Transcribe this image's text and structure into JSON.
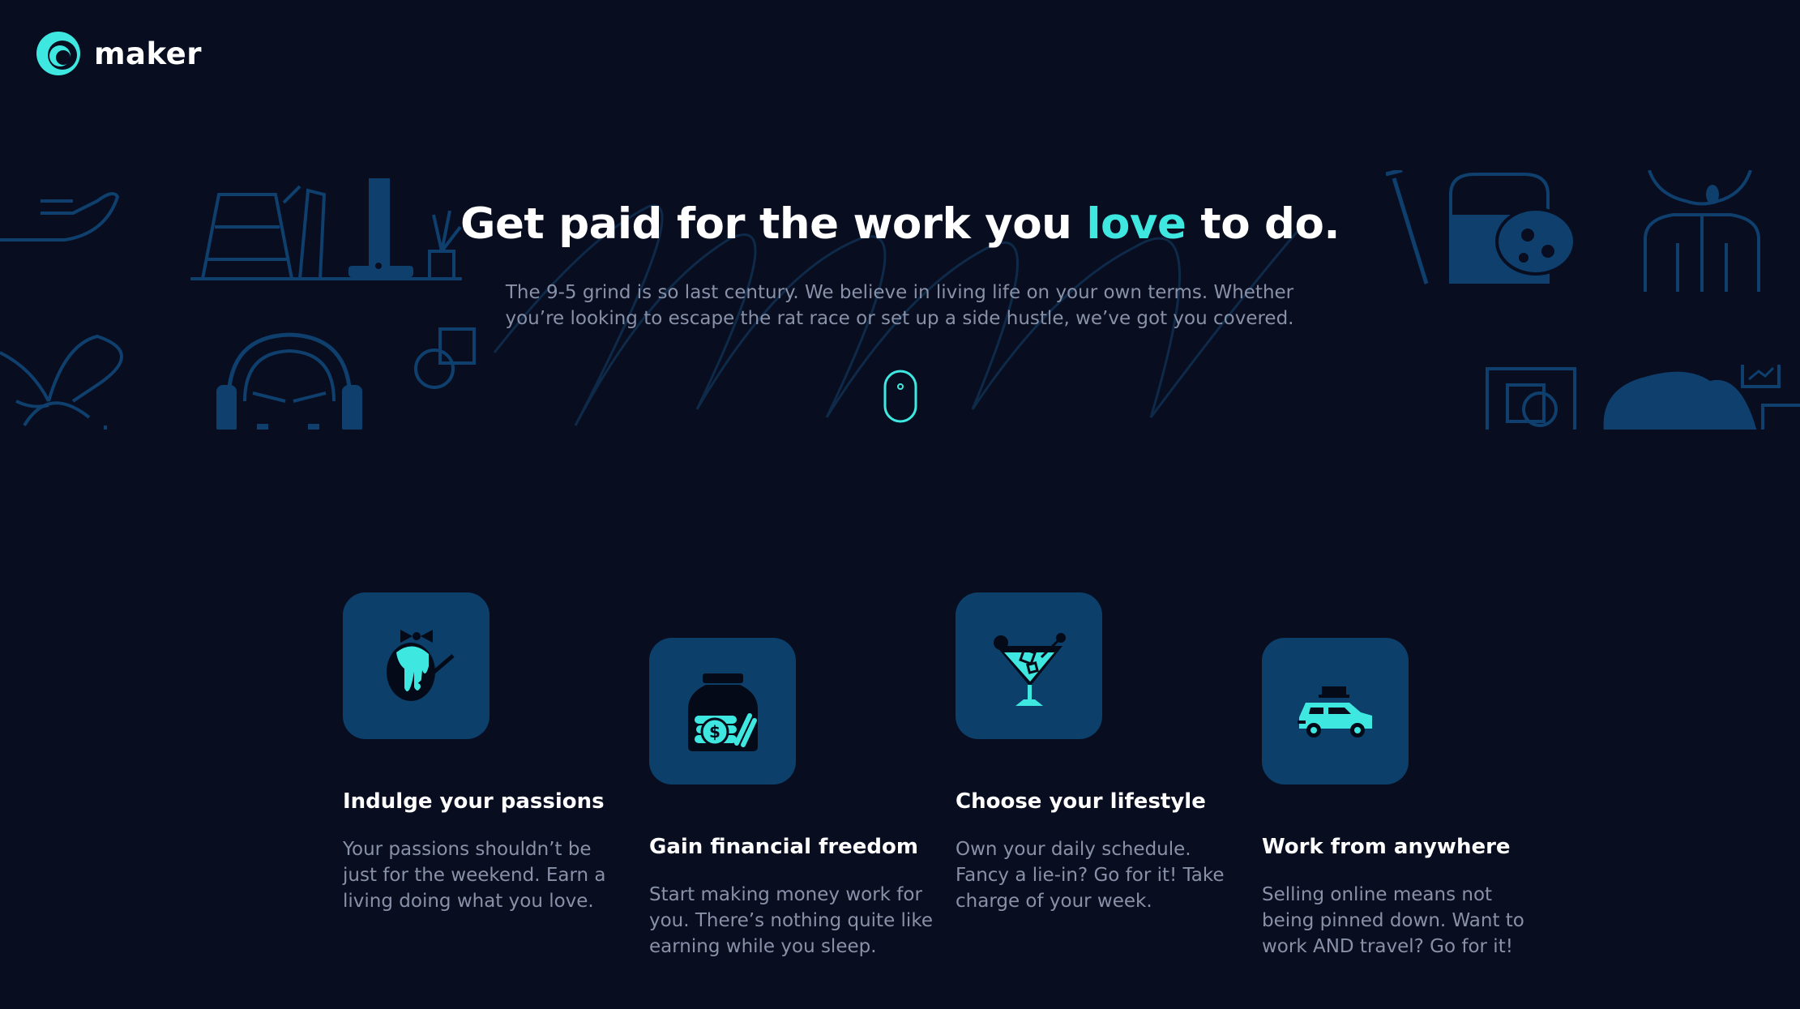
{
  "brand": {
    "name": "maker",
    "accent_color": "#3ee8e0",
    "background_color": "#080d20",
    "logo_icon": "maker-logo-icon"
  },
  "hero": {
    "title_before": "Get paid for the work you ",
    "title_accent": "love",
    "title_after": " to do.",
    "subtitle": "The 9-5 grind is so last century. We believe in living life on your own terms. Whether you’re looking to escape the rat race or set up a side hustle, we’ve got you covered.",
    "scroll_icon": "mouse-scroll-icon"
  },
  "features": [
    {
      "icon": "paint-passion-icon",
      "title": "Indulge your passions",
      "description": "Your passions shouldn’t be just for the weekend. Earn a living doing what you love."
    },
    {
      "icon": "money-jar-icon",
      "title": "Gain financial freedom",
      "description": "Start making money work for you. There’s nothing quite like earning while you sleep."
    },
    {
      "icon": "cocktail-icon",
      "title": "Choose your lifestyle",
      "description": "Own your daily schedule. Fancy a lie-in? Go for it! Take charge of your week."
    },
    {
      "icon": "car-travel-icon",
      "title": "Work from anywhere",
      "description": "Selling online means not being pinned down. Want to work AND travel? Go for it!"
    }
  ]
}
